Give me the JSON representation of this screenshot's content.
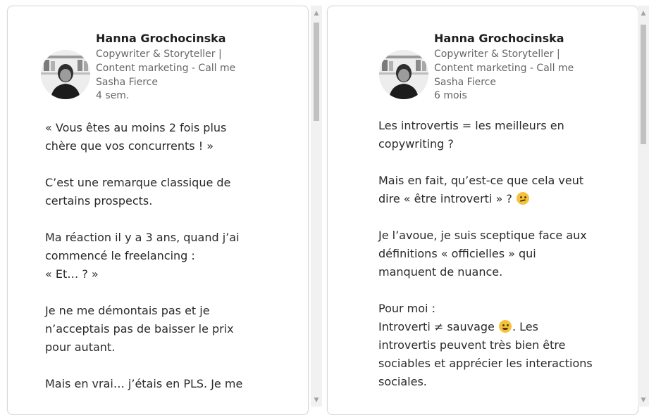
{
  "posts": [
    {
      "author_name": "Hanna Grochocinska",
      "headline_lines": [
        "Copywriter & Storyteller |",
        "Content marketing - Call me",
        "Sasha Fierce"
      ],
      "time": "4 sem.",
      "text_lines": [
        "« Vous êtes au moins 2 fois plus",
        "chère que vos concurrents ! »",
        "",
        "C’est une remarque classique de",
        "certains prospects.",
        "",
        "Ma réaction il y a 3 ans, quand j’ai",
        "commencé le freelancing :",
        "« Et… ? »",
        "",
        "Je ne me démontais pas et je",
        "n’acceptais pas de baisser le prix",
        "pour autant.",
        "",
        "Mais en vrai… j’étais en PLS. Je me"
      ]
    },
    {
      "author_name": "Hanna Grochocinska",
      "headline_lines": [
        "Copywriter & Storyteller |",
        "Content marketing - Call me",
        "Sasha Fierce"
      ],
      "time": "6 mois",
      "text_lines": [
        "Les introvertis = les meilleurs en",
        "copywriting ?",
        "",
        "Mais en fait, qu’est-ce que cela veut",
        "dire « être introverti » ?",
        "",
        "Je l’avoue, je suis sceptique face aux",
        "définitions « officielles » qui",
        "manquent de nuance.",
        "",
        "Pour moi :",
        "Introverti ≠ sauvage",
        "introvertis peuvent très bien être",
        "sociables et apprécier les interactions",
        "sociales."
      ],
      "line_12_suffix": ". Les"
    }
  ],
  "emojis": {
    "thinking": "thinking-face-icon",
    "smirk": "smirking-face-icon"
  },
  "scroll_up_glyph": "▲",
  "scroll_down_glyph": "▼",
  "colors": {
    "accent_text": "#1f1f1f",
    "secondary_text": "#666666",
    "scroll_thumb": "#c1c1c1"
  }
}
